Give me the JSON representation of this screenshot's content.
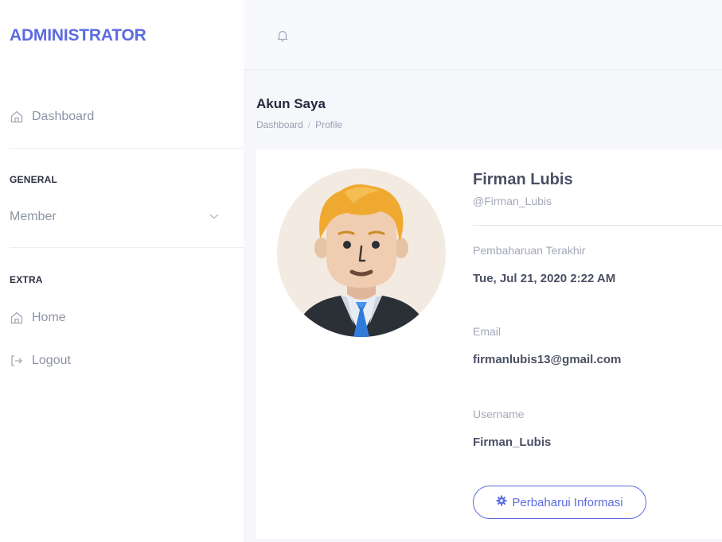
{
  "sidebar": {
    "brand": "ADMINISTRATOR",
    "dashboard_label": "Dashboard",
    "section_general": "GENERAL",
    "member_label": "Member",
    "section_extra": "EXTRA",
    "home_label": "Home",
    "logout_label": "Logout"
  },
  "topbar": {
    "bell_icon": "bell-icon"
  },
  "page": {
    "title": "Akun Saya",
    "breadcrumb": [
      "Dashboard",
      "/",
      "Profile"
    ]
  },
  "profile": {
    "name": "Firman Lubis",
    "handle": "@Firman_Lubis",
    "last_update_label": "Pembaharuan Terakhir",
    "last_update_value": "Tue, Jul 21, 2020 2:22 AM",
    "email_label": "Email",
    "email_value": "firmanlubis13@gmail.com",
    "username_label": "Username",
    "username_value": "Firman_Lubis",
    "update_button": "Perbaharui Informasi"
  },
  "colors": {
    "accent": "#5b6be0",
    "muted": "#8d93a5"
  }
}
